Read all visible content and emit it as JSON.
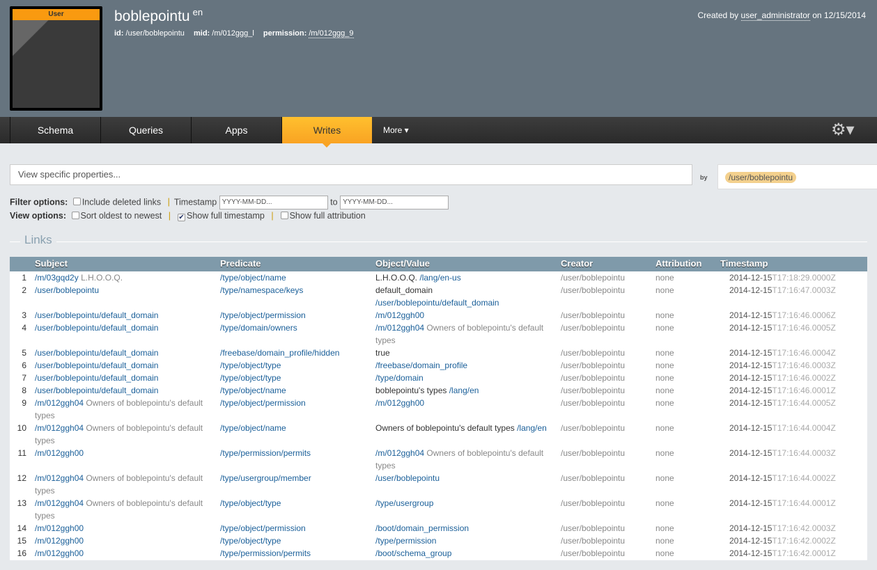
{
  "header": {
    "badge": "User",
    "title": "boblepointu",
    "lang": "en",
    "id_label": "id:",
    "id": "/user/boblepointu",
    "mid_label": "mid:",
    "mid": "/m/012ggg_l",
    "perm_label": "permission:",
    "perm": "/m/012ggg_9",
    "created_prefix": "Created by",
    "created_user": "user_administrator",
    "created_on": "on 12/15/2014"
  },
  "nav": {
    "tabs": [
      "Schema",
      "Queries",
      "Apps",
      "Writes"
    ],
    "active": "Writes",
    "more": "More ▾",
    "gear": "gear-icon"
  },
  "search": {
    "placeholder": "View specific properties...",
    "by": "by",
    "user": "/user/boblepointu"
  },
  "filter": {
    "label": "Filter options:",
    "deleted": "Include deleted links",
    "timestamp": "Timestamp",
    "ph": "YYYY-MM-DD...",
    "to": "to"
  },
  "view": {
    "label": "View options:",
    "sort": "Sort oldest to newest",
    "full_ts": "Show full timestamp",
    "full_ts_checked": true,
    "full_attr": "Show full attribution"
  },
  "section": "Links",
  "columns": [
    "Subject",
    "Predicate",
    "Object/Value",
    "Creator",
    "Attribution",
    "Timestamp"
  ],
  "rows": [
    {
      "n": "1",
      "s": "/m/03gqd2y",
      "sl": "L.H.O.O.Q.",
      "p": "/type/object/name",
      "ot": "L.H.O.O.Q.",
      "o": "/lang/en-us",
      "c": "/user/boblepointu",
      "a": "none",
      "d": "2014-12-15",
      "t": "T17:18:29.0000Z"
    },
    {
      "n": "2",
      "s": "/user/boblepointu",
      "p": "/type/namespace/keys",
      "ot": "default_domain",
      "o": "/user/boblepointu/default_domain",
      "c": "/user/boblepointu",
      "a": "none",
      "d": "2014-12-15",
      "t": "T17:16:47.0003Z"
    },
    {
      "n": "3",
      "s": "/user/boblepointu/default_domain",
      "p": "/type/object/permission",
      "o": "/m/012ggh00",
      "c": "/user/boblepointu",
      "a": "none",
      "d": "2014-12-15",
      "t": "T17:16:46.0006Z"
    },
    {
      "n": "4",
      "s": "/user/boblepointu/default_domain",
      "p": "/type/domain/owners",
      "o": "/m/012ggh04",
      "ol": "Owners of boblepointu's default types",
      "c": "/user/boblepointu",
      "a": "none",
      "d": "2014-12-15",
      "t": "T17:16:46.0005Z"
    },
    {
      "n": "5",
      "s": "/user/boblepointu/default_domain",
      "p": "/freebase/domain_profile/hidden",
      "ot": "true",
      "c": "/user/boblepointu",
      "a": "none",
      "d": "2014-12-15",
      "t": "T17:16:46.0004Z"
    },
    {
      "n": "6",
      "s": "/user/boblepointu/default_domain",
      "p": "/type/object/type",
      "o": "/freebase/domain_profile",
      "c": "/user/boblepointu",
      "a": "none",
      "d": "2014-12-15",
      "t": "T17:16:46.0003Z"
    },
    {
      "n": "7",
      "s": "/user/boblepointu/default_domain",
      "p": "/type/object/type",
      "o": "/type/domain",
      "c": "/user/boblepointu",
      "a": "none",
      "d": "2014-12-15",
      "t": "T17:16:46.0002Z"
    },
    {
      "n": "8",
      "s": "/user/boblepointu/default_domain",
      "p": "/type/object/name",
      "ot": "boblepointu's types",
      "o": "/lang/en",
      "c": "/user/boblepointu",
      "a": "none",
      "d": "2014-12-15",
      "t": "T17:16:46.0001Z"
    },
    {
      "n": "9",
      "s": "/m/012ggh04",
      "sl": "Owners of boblepointu's default types",
      "p": "/type/object/permission",
      "o": "/m/012ggh00",
      "c": "/user/boblepointu",
      "a": "none",
      "d": "2014-12-15",
      "t": "T17:16:44.0005Z"
    },
    {
      "n": "10",
      "s": "/m/012ggh04",
      "sl": "Owners of boblepointu's default types",
      "p": "/type/object/name",
      "ot": "Owners of boblepointu's default types",
      "o": "/lang/en",
      "c": "/user/boblepointu",
      "a": "none",
      "d": "2014-12-15",
      "t": "T17:16:44.0004Z"
    },
    {
      "n": "11",
      "s": "/m/012ggh00",
      "p": "/type/permission/permits",
      "o": "/m/012ggh04",
      "ol": "Owners of boblepointu's default types",
      "c": "/user/boblepointu",
      "a": "none",
      "d": "2014-12-15",
      "t": "T17:16:44.0003Z"
    },
    {
      "n": "12",
      "s": "/m/012ggh04",
      "sl": "Owners of boblepointu's default types",
      "p": "/type/usergroup/member",
      "o": "/user/boblepointu",
      "c": "/user/boblepointu",
      "a": "none",
      "d": "2014-12-15",
      "t": "T17:16:44.0002Z"
    },
    {
      "n": "13",
      "s": "/m/012ggh04",
      "sl": "Owners of boblepointu's default types",
      "p": "/type/object/type",
      "o": "/type/usergroup",
      "c": "/user/boblepointu",
      "a": "none",
      "d": "2014-12-15",
      "t": "T17:16:44.0001Z"
    },
    {
      "n": "14",
      "s": "/m/012ggh00",
      "p": "/type/object/permission",
      "o": "/boot/domain_permission",
      "c": "/user/boblepointu",
      "a": "none",
      "d": "2014-12-15",
      "t": "T17:16:42.0003Z"
    },
    {
      "n": "15",
      "s": "/m/012ggh00",
      "p": "/type/object/type",
      "o": "/type/permission",
      "c": "/user/boblepointu",
      "a": "none",
      "d": "2014-12-15",
      "t": "T17:16:42.0002Z"
    },
    {
      "n": "16",
      "s": "/m/012ggh00",
      "p": "/type/permission/permits",
      "o": "/boot/schema_group",
      "c": "/user/boblepointu",
      "a": "none",
      "d": "2014-12-15",
      "t": "T17:16:42.0001Z"
    }
  ]
}
